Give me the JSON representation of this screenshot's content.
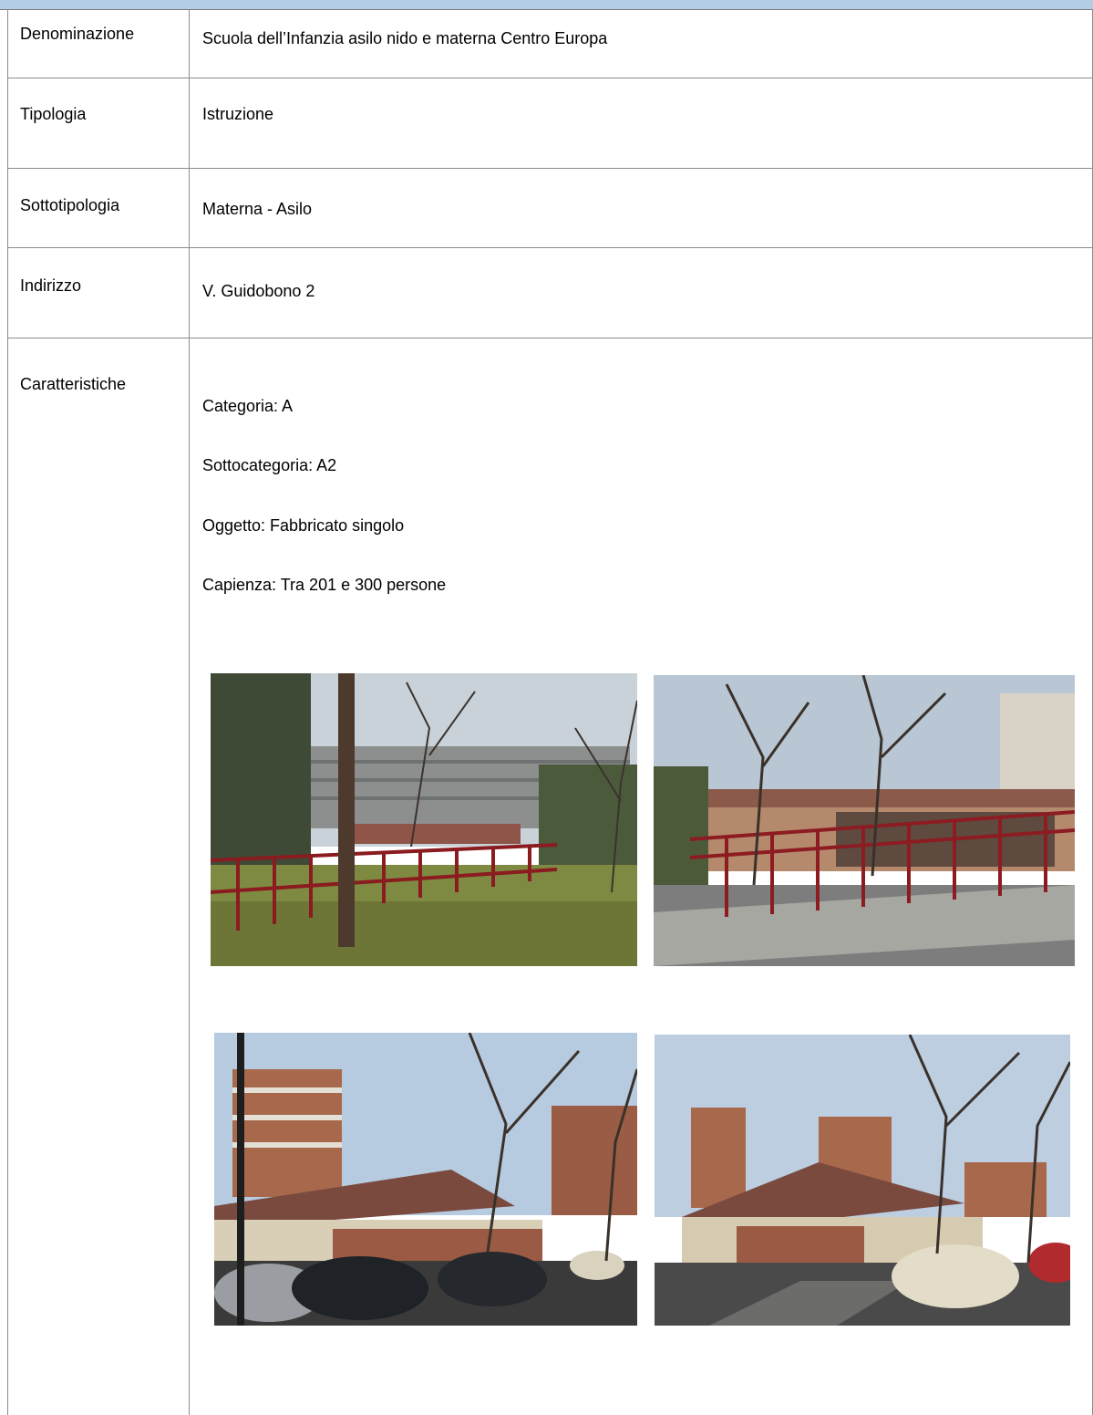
{
  "rows": [
    {
      "label": "Denominazione",
      "value": "Scuola dell’Infanzia asilo nido e materna Centro Europa"
    },
    {
      "label": "Tipologia",
      "value": "Istruzione"
    },
    {
      "label": "Sottotipologia",
      "value": "Materna - Asilo"
    },
    {
      "label": "Indirizzo",
      "value": "V. Guidobono 2"
    },
    {
      "label": "Caratteristiche"
    }
  ],
  "characteristics": [
    "Categoria: A",
    "Sottocategoria: A2",
    "Oggetto: Fabbricato singolo",
    "Capienza: Tra 201 e 300 persone"
  ],
  "photos": [
    {
      "subject": "garden-with-fence-photo"
    },
    {
      "subject": "school-building-fence-photo"
    },
    {
      "subject": "school-with-cars-photo"
    },
    {
      "subject": "school-entrance-cars-photo"
    }
  ],
  "colors": {
    "header_band": "#b4cde6",
    "grid_line": "#8c8c8c"
  }
}
